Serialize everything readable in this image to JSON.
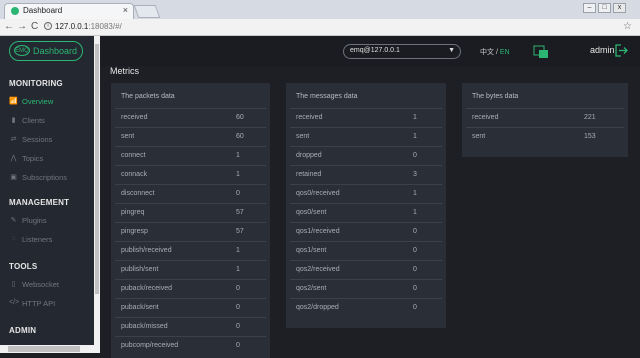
{
  "browser": {
    "tab_title": "Dashboard",
    "tab_close": "×",
    "url_host": "127.0.0.1",
    "url_rest": ":18083/#/",
    "back": "←",
    "forward": "→",
    "reload": "C",
    "star": "☆",
    "min": "–",
    "max": "□",
    "close": "x"
  },
  "app": {
    "logo_mark": "EMQ",
    "logo_name": "Dashboard",
    "accent": "#2bb673"
  },
  "header": {
    "node": "emq@127.0.0.1",
    "node_dropdown": "▼",
    "lang_cn": "中文 / ",
    "lang_en": "EN",
    "user": "admin"
  },
  "sidebar": {
    "monitoring_title": "MONITORING",
    "monitoring": [
      {
        "label": "Overview",
        "icon": "chart-icon",
        "glyph": "📶",
        "active": true
      },
      {
        "label": "Clients",
        "icon": "clients-icon",
        "glyph": "▮"
      },
      {
        "label": "Sessions",
        "icon": "sessions-icon",
        "glyph": "⇄"
      },
      {
        "label": "Topics",
        "icon": "topics-icon",
        "glyph": "⋀"
      },
      {
        "label": "Subscriptions",
        "icon": "subscriptions-icon",
        "glyph": "▣"
      }
    ],
    "management_title": "MANAGEMENT",
    "management": [
      {
        "label": "Plugins",
        "icon": "plugins-icon",
        "glyph": "✎"
      },
      {
        "label": "Listeners",
        "icon": "listeners-icon",
        "glyph": "◌"
      }
    ],
    "tools_title": "TOOLS",
    "tools": [
      {
        "label": "Websocket",
        "icon": "websocket-icon",
        "glyph": "▯"
      },
      {
        "label": "HTTP API",
        "icon": "api-icon",
        "glyph": "</>"
      }
    ],
    "admin_title": "ADMIN"
  },
  "main": {
    "title": "Metrics",
    "cards": [
      {
        "title": "The packets data",
        "rows": [
          {
            "k": "received",
            "v": "60"
          },
          {
            "k": "sent",
            "v": "60"
          },
          {
            "k": "connect",
            "v": "1"
          },
          {
            "k": "connack",
            "v": "1"
          },
          {
            "k": "disconnect",
            "v": "0"
          },
          {
            "k": "pingreq",
            "v": "57"
          },
          {
            "k": "pingresp",
            "v": "57"
          },
          {
            "k": "publish/received",
            "v": "1"
          },
          {
            "k": "publish/sent",
            "v": "1"
          },
          {
            "k": "puback/received",
            "v": "0"
          },
          {
            "k": "puback/sent",
            "v": "0"
          },
          {
            "k": "puback/missed",
            "v": "0"
          },
          {
            "k": "pubcomp/received",
            "v": "0"
          }
        ]
      },
      {
        "title": "The messages data",
        "rows": [
          {
            "k": "received",
            "v": "1"
          },
          {
            "k": "sent",
            "v": "1"
          },
          {
            "k": "dropped",
            "v": "0"
          },
          {
            "k": "retained",
            "v": "3"
          },
          {
            "k": "qos0/received",
            "v": "1"
          },
          {
            "k": "qos0/sent",
            "v": "1"
          },
          {
            "k": "qos1/received",
            "v": "0"
          },
          {
            "k": "qos1/sent",
            "v": "0"
          },
          {
            "k": "qos2/received",
            "v": "0"
          },
          {
            "k": "qos2/sent",
            "v": "0"
          },
          {
            "k": "qos2/dropped",
            "v": "0"
          }
        ]
      },
      {
        "title": "The bytes data",
        "rows": [
          {
            "k": "received",
            "v": "221"
          },
          {
            "k": "sent",
            "v": "153"
          }
        ]
      }
    ]
  }
}
